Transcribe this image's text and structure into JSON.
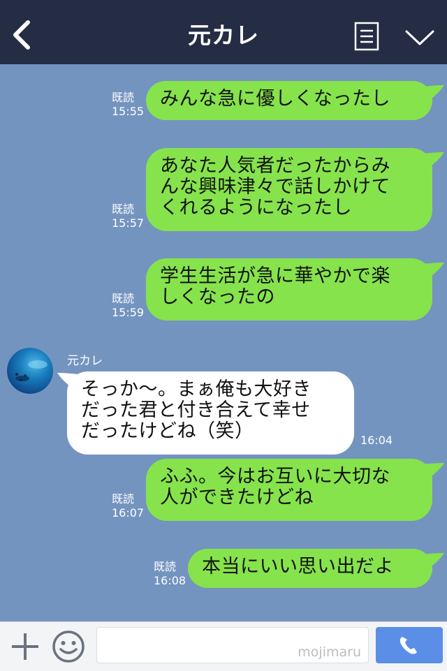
{
  "header": {
    "title": "元カレ"
  },
  "messages": [
    {
      "read": "既読",
      "time": "15:55",
      "text": "みんな急に優しくなったし"
    },
    {
      "read": "既読",
      "time": "15:57",
      "text": "あなた人気者だったからみ\nんな興味津々で話しかけて\nくれるようになったし"
    },
    {
      "read": "既読",
      "time": "15:59",
      "text": "学生生活が急に華やかで楽\nしくなったの"
    },
    {
      "sender": "元カレ",
      "time": "16:04",
      "text": "そっか〜。まぁ俺も大好き\nだった君と付き合えて幸せ\nだったけどね（笑）"
    },
    {
      "read": "既読",
      "time": "16:07",
      "text": "ふふ。今はお互いに大切な\n人ができたけどね"
    },
    {
      "read": "既読",
      "time": "16:08",
      "text": "本当にいい思い出だよ"
    }
  ],
  "footer": {
    "watermark": "mojimaru"
  },
  "colors": {
    "header": "#242d43",
    "background": "#7494c0",
    "sent_bubble": "#86e34c",
    "received_bubble": "#ffffff",
    "call_button": "#5b8ee6"
  },
  "icons": {
    "back": "back-chevron-icon",
    "menu": "menu-list-icon",
    "collapse": "chevron-down-icon",
    "add": "plus-icon",
    "emoji": "smiley-icon",
    "call": "phone-icon"
  }
}
